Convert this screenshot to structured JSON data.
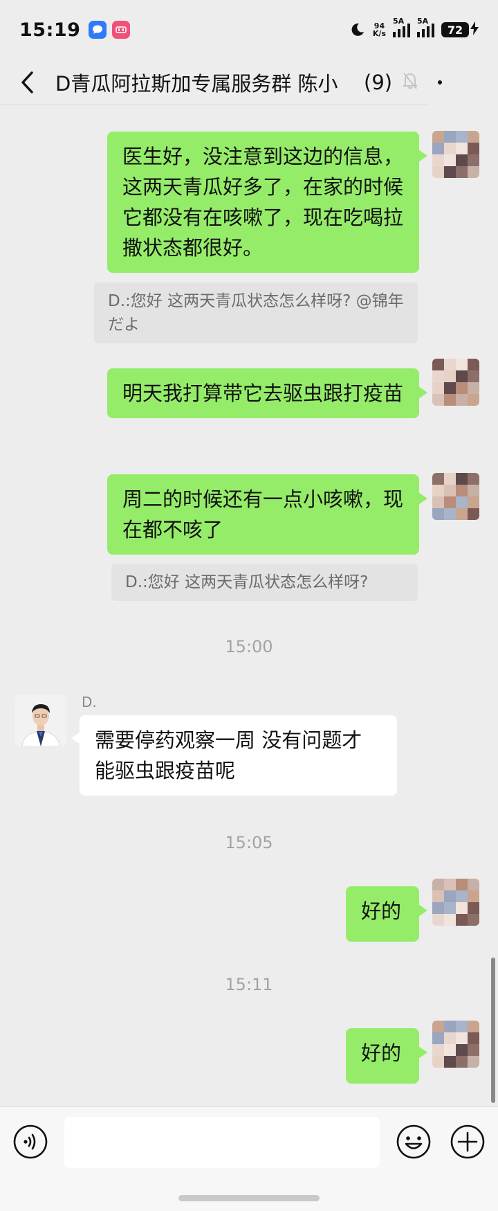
{
  "status_bar": {
    "time": "15:19",
    "net_speed_value": "94",
    "net_speed_unit": "K/s",
    "signal_1_label": "5A",
    "signal_2_label": "5A",
    "battery": "72"
  },
  "header": {
    "title": "D青瓜阿拉斯加专属服务群 陈小",
    "member_count": "(9)"
  },
  "messages": [
    {
      "type": "outgoing",
      "text": "医生好，没注意到这边的信息，这两天青瓜好多了，在家的时候它都没有在咳嗽了，现在吃喝拉撒状态都很好。"
    },
    {
      "type": "quote",
      "text": "D.:您好 这两天青瓜状态怎么样呀? @锦年だよ"
    },
    {
      "type": "outgoing",
      "text": "明天我打算带它去驱虫跟打疫苗"
    },
    {
      "type": "outgoing",
      "text": "周二的时候还有一点小咳嗽，现在都不咳了"
    },
    {
      "type": "quote",
      "text": "D.:您好 这两天青瓜状态怎么样呀?"
    },
    {
      "type": "timestamp",
      "text": "15:00"
    },
    {
      "type": "incoming",
      "sender": "D.",
      "text": "需要停药观察一周 没有问题才能驱虫跟疫苗呢"
    },
    {
      "type": "timestamp",
      "text": "15:05"
    },
    {
      "type": "outgoing",
      "text": "好的"
    },
    {
      "type": "timestamp",
      "text": "15:11"
    },
    {
      "type": "outgoing",
      "text": "好的"
    }
  ],
  "input": {
    "value": ""
  },
  "icons": {
    "back": "chevron-left-icon",
    "mute": "bell-off-icon",
    "more": "more-dot-icon",
    "voice": "voice-icon",
    "emoji": "emoji-icon",
    "plus": "plus-icon"
  },
  "colors": {
    "background": "#ededed",
    "outgoing_bubble": "#95ec69",
    "incoming_bubble": "#ffffff",
    "quote_bg": "#e3e3e3",
    "timestamp_text": "#a3a3a3"
  }
}
